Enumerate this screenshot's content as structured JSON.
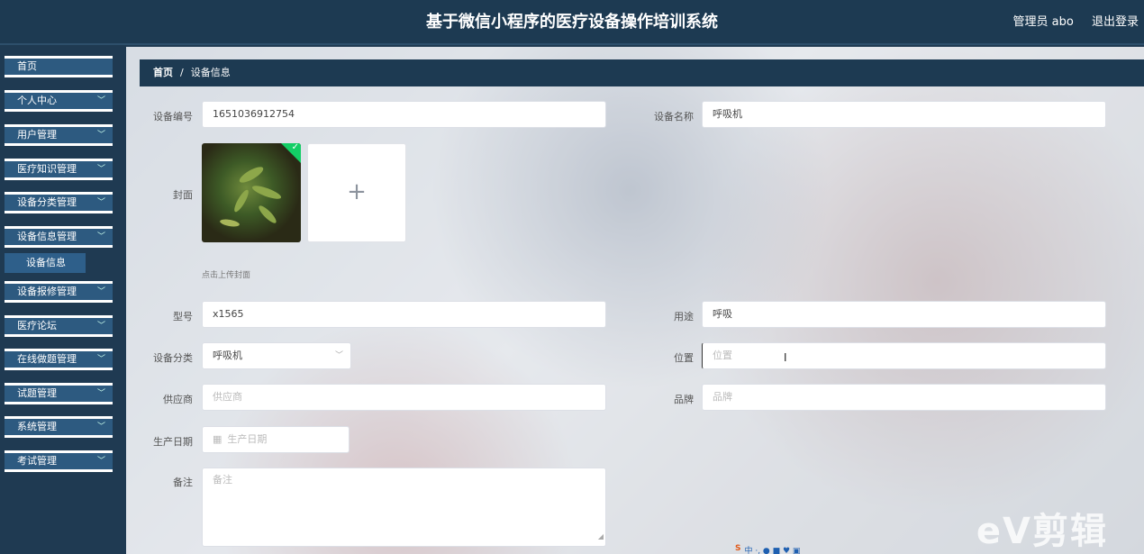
{
  "header": {
    "title": "基于微信小程序的医疗设备操作培训系统",
    "user": "管理员 abo",
    "logout": "退出登录"
  },
  "sidebar": {
    "items": [
      {
        "label": "首页",
        "has_submenu": false
      },
      {
        "label": "个人中心",
        "has_submenu": true
      },
      {
        "label": "用户管理",
        "has_submenu": true
      },
      {
        "label": "医疗知识管理",
        "has_submenu": true
      },
      {
        "label": "设备分类管理",
        "has_submenu": true
      },
      {
        "label": "设备信息管理",
        "has_submenu": true
      },
      {
        "label": "设备报修管理",
        "has_submenu": true
      },
      {
        "label": "医疗论坛",
        "has_submenu": true
      },
      {
        "label": "在线做题管理",
        "has_submenu": true
      },
      {
        "label": "试题管理",
        "has_submenu": true
      },
      {
        "label": "系统管理",
        "has_submenu": true
      },
      {
        "label": "考试管理",
        "has_submenu": true
      }
    ],
    "active_submenu": "设备信息"
  },
  "breadcrumb": {
    "home": "首页",
    "separator": "/",
    "current": "设备信息"
  },
  "form": {
    "device_no": {
      "label": "设备编号",
      "value": "1651036912754"
    },
    "device_name": {
      "label": "设备名称",
      "value": "呼吸机"
    },
    "cover": {
      "label": "封面",
      "hint": "点击上传封面",
      "add_icon": "plus-icon"
    },
    "model": {
      "label": "型号",
      "value": "x1565"
    },
    "usage": {
      "label": "用途",
      "value": "呼吸"
    },
    "category": {
      "label": "设备分类",
      "value": "呼吸机"
    },
    "location": {
      "label": "位置",
      "placeholder": "位置"
    },
    "supplier": {
      "label": "供应商",
      "placeholder": "供应商"
    },
    "brand": {
      "label": "品牌",
      "placeholder": "品牌"
    },
    "production_date": {
      "label": "生产日期",
      "placeholder": "生产日期",
      "icon": "calendar-icon"
    },
    "remark": {
      "label": "备注",
      "placeholder": "备注"
    }
  },
  "watermark": "eV剪辑",
  "colors": {
    "header_bg": "#1d3a52",
    "menu_bg": "#2d5a80",
    "upload_success": "#13ce66"
  }
}
